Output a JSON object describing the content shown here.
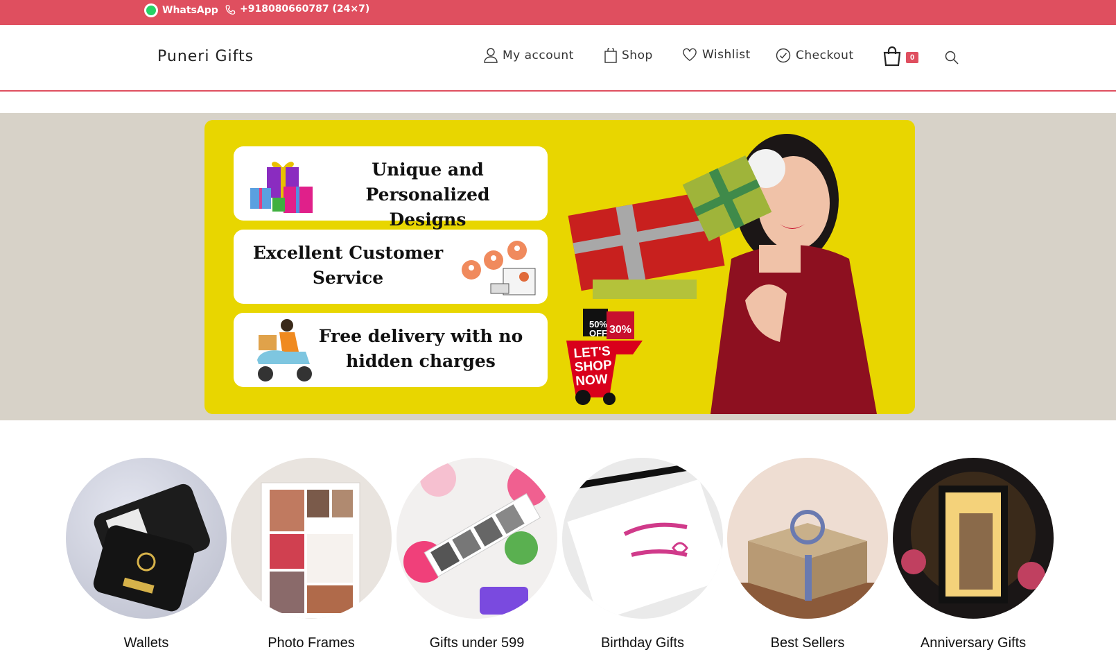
{
  "topbar": {
    "whatsapp_label": "WhatsApp",
    "phone_label": "+918080660787 (24×7)"
  },
  "header": {
    "logo": "Puneri Gifts",
    "nav": {
      "account": "My account",
      "shop": "Shop",
      "wishlist": "Wishlist",
      "checkout": "Checkout"
    },
    "cart_count": "0"
  },
  "banner": {
    "features": [
      "Unique and Personalized Designs",
      "Excellent Customer Service",
      "Free delivery with no hidden charges"
    ],
    "promo": {
      "off1": "50% OFF",
      "off2": "30%",
      "cta": "LET'S SHOP NOW"
    }
  },
  "categories": [
    "Wallets",
    "Photo Frames",
    "Gifts under 599",
    "Birthday Gifts",
    "Best Sellers",
    "Anniversary Gifts"
  ],
  "colors": {
    "accent": "#df4f5f",
    "banner_yellow": "#e8d600",
    "band": "#d7d2c8"
  }
}
